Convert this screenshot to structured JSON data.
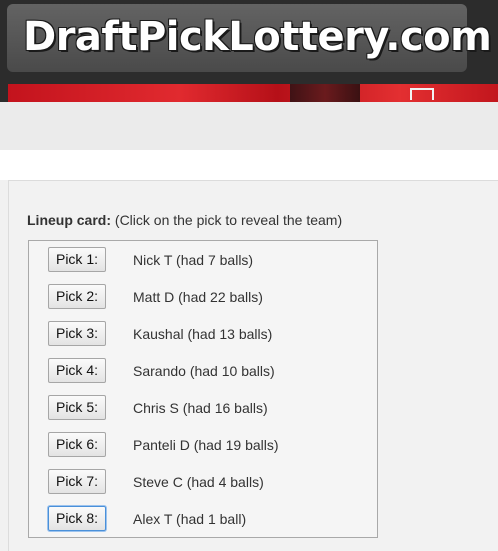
{
  "site": {
    "logo_text": "DraftPickLottery.com"
  },
  "lineup": {
    "heading_bold": "Lineup card:",
    "heading_note": " (Click on the pick to reveal the team)",
    "picks": [
      {
        "button": "Pick 1:",
        "name": "Nick T (had 7 balls)"
      },
      {
        "button": "Pick 2:",
        "name": "Matt D (had 22 balls)"
      },
      {
        "button": "Pick 3:",
        "name": "Kaushal (had 13 balls)"
      },
      {
        "button": "Pick 4:",
        "name": "Sarando (had 10 balls)"
      },
      {
        "button": "Pick 5:",
        "name": "Chris S (had 16 balls)"
      },
      {
        "button": "Pick 6:",
        "name": "Panteli D (had 19 balls)"
      },
      {
        "button": "Pick 7:",
        "name": "Steve C (had 4 balls)"
      },
      {
        "button": "Pick 8:",
        "name": "Alex T (had 1 ball)"
      }
    ]
  },
  "colors": {
    "header_bg": "#2c2c2c",
    "banner_red": "#d21e25",
    "page_bg": "#f1f1f1",
    "focus_blue": "#4a90d9"
  }
}
